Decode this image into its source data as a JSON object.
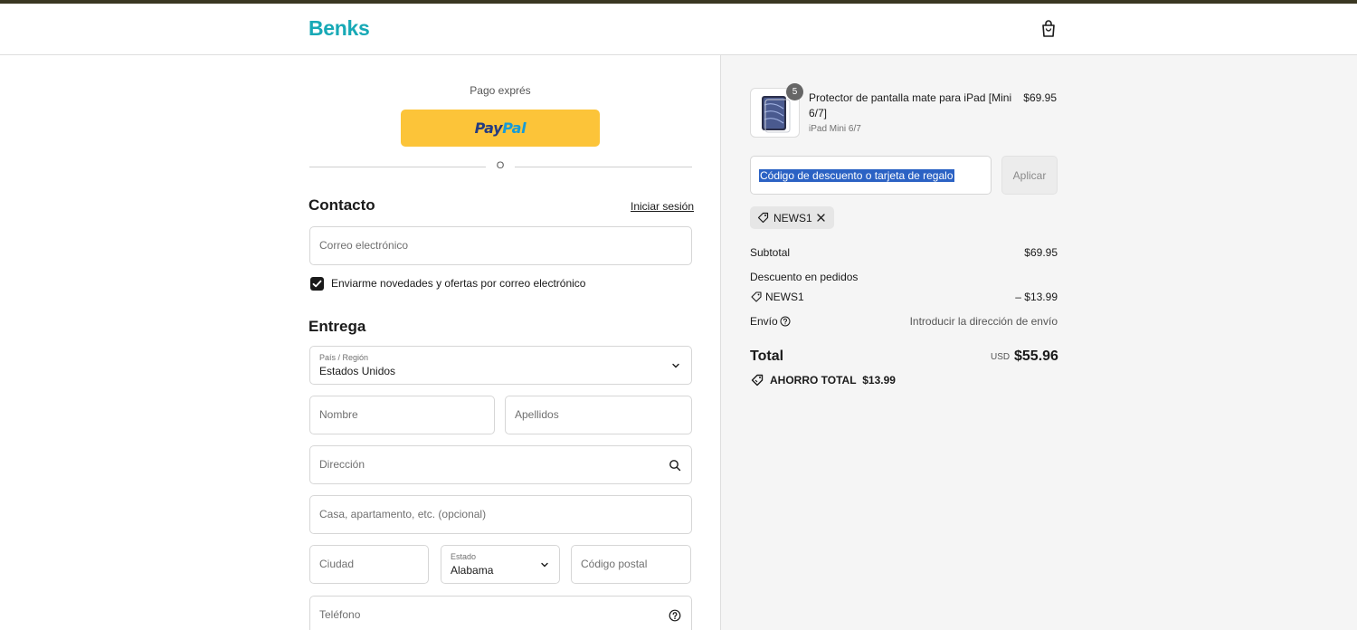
{
  "header": {
    "logo": "Benks",
    "cart_icon": "shopping-bag-icon"
  },
  "express": {
    "label": "Pago exprés",
    "paypal_a": "Pay",
    "paypal_b": "Pal",
    "or": "O"
  },
  "contact": {
    "title": "Contacto",
    "login_link": "Iniciar sesión",
    "email_placeholder": "Correo electrónico",
    "newsletter_label": "Enviarme novedades y ofertas por correo electrónico",
    "newsletter_checked": true
  },
  "delivery": {
    "title": "Entrega",
    "country_label": "País / Región",
    "country_value": "Estados Unidos",
    "first_name_placeholder": "Nombre",
    "last_name_placeholder": "Apellidos",
    "address_placeholder": "Dirección",
    "apartment_placeholder": "Casa, apartamento, etc. (opcional)",
    "city_placeholder": "Ciudad",
    "state_label": "Estado",
    "state_value": "Alabama",
    "zip_placeholder": "Código postal",
    "phone_placeholder": "Teléfono"
  },
  "order": {
    "product": {
      "quantity": "5",
      "name": "Protector de pantalla mate para iPad [Mini 6/7]",
      "variant": "iPad Mini 6/7",
      "price": "$69.95"
    },
    "discount_placeholder": "Código de descuento o tarjeta de regalo",
    "apply_button": "Aplicar",
    "applied_code": "NEWS1",
    "subtotal_label": "Subtotal",
    "subtotal_value": "$69.95",
    "order_discount_label": "Descuento en pedidos",
    "discount_code": "NEWS1",
    "discount_value": "– $13.99",
    "shipping_label": "Envío",
    "shipping_value": "Introducir la dirección de envío",
    "total_label": "Total",
    "total_currency": "USD",
    "total_value": "$55.96",
    "savings_label": "AHORRO TOTAL",
    "savings_value": "$13.99"
  },
  "colors": {
    "brand": "#18a9b6",
    "paypal": "#fcc439",
    "topbar": "#3a3722",
    "panel": "#f5f5f5"
  }
}
